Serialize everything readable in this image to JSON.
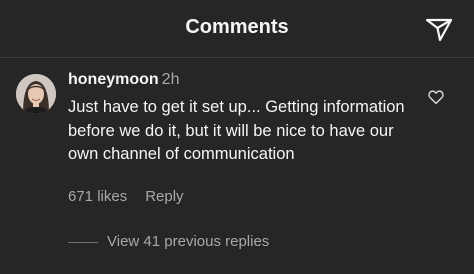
{
  "header": {
    "title": "Comments",
    "send_icon": "paper-plane-icon"
  },
  "comment": {
    "username": "honeymoon",
    "time": "2h",
    "text": "Just have to get it set up... Getting information before we do it, but it will be nice to have our own channel of communication",
    "likes": "671 likes",
    "reply_label": "Reply",
    "like_icon": "heart-outline-icon"
  },
  "replies": {
    "label": "View 41 previous replies"
  },
  "colors": {
    "background": "#262626",
    "primary_text": "#f5f5f5",
    "secondary_text": "#a8a8a8"
  }
}
